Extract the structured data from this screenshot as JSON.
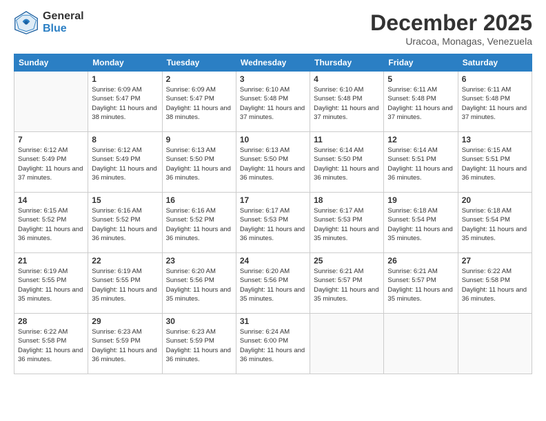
{
  "logo": {
    "general": "General",
    "blue": "Blue"
  },
  "title": "December 2025",
  "subtitle": "Uracoa, Monagas, Venezuela",
  "days_header": [
    "Sunday",
    "Monday",
    "Tuesday",
    "Wednesday",
    "Thursday",
    "Friday",
    "Saturday"
  ],
  "weeks": [
    [
      {
        "day": "",
        "sunrise": "",
        "sunset": "",
        "daylight": ""
      },
      {
        "day": "1",
        "sunrise": "6:09 AM",
        "sunset": "5:47 PM",
        "daylight": "11 hours and 38 minutes."
      },
      {
        "day": "2",
        "sunrise": "6:09 AM",
        "sunset": "5:47 PM",
        "daylight": "11 hours and 38 minutes."
      },
      {
        "day": "3",
        "sunrise": "6:10 AM",
        "sunset": "5:48 PM",
        "daylight": "11 hours and 37 minutes."
      },
      {
        "day": "4",
        "sunrise": "6:10 AM",
        "sunset": "5:48 PM",
        "daylight": "11 hours and 37 minutes."
      },
      {
        "day": "5",
        "sunrise": "6:11 AM",
        "sunset": "5:48 PM",
        "daylight": "11 hours and 37 minutes."
      },
      {
        "day": "6",
        "sunrise": "6:11 AM",
        "sunset": "5:48 PM",
        "daylight": "11 hours and 37 minutes."
      }
    ],
    [
      {
        "day": "7",
        "sunrise": "6:12 AM",
        "sunset": "5:49 PM",
        "daylight": "11 hours and 37 minutes."
      },
      {
        "day": "8",
        "sunrise": "6:12 AM",
        "sunset": "5:49 PM",
        "daylight": "11 hours and 36 minutes."
      },
      {
        "day": "9",
        "sunrise": "6:13 AM",
        "sunset": "5:50 PM",
        "daylight": "11 hours and 36 minutes."
      },
      {
        "day": "10",
        "sunrise": "6:13 AM",
        "sunset": "5:50 PM",
        "daylight": "11 hours and 36 minutes."
      },
      {
        "day": "11",
        "sunrise": "6:14 AM",
        "sunset": "5:50 PM",
        "daylight": "11 hours and 36 minutes."
      },
      {
        "day": "12",
        "sunrise": "6:14 AM",
        "sunset": "5:51 PM",
        "daylight": "11 hours and 36 minutes."
      },
      {
        "day": "13",
        "sunrise": "6:15 AM",
        "sunset": "5:51 PM",
        "daylight": "11 hours and 36 minutes."
      }
    ],
    [
      {
        "day": "14",
        "sunrise": "6:15 AM",
        "sunset": "5:52 PM",
        "daylight": "11 hours and 36 minutes."
      },
      {
        "day": "15",
        "sunrise": "6:16 AM",
        "sunset": "5:52 PM",
        "daylight": "11 hours and 36 minutes."
      },
      {
        "day": "16",
        "sunrise": "6:16 AM",
        "sunset": "5:52 PM",
        "daylight": "11 hours and 36 minutes."
      },
      {
        "day": "17",
        "sunrise": "6:17 AM",
        "sunset": "5:53 PM",
        "daylight": "11 hours and 36 minutes."
      },
      {
        "day": "18",
        "sunrise": "6:17 AM",
        "sunset": "5:53 PM",
        "daylight": "11 hours and 35 minutes."
      },
      {
        "day": "19",
        "sunrise": "6:18 AM",
        "sunset": "5:54 PM",
        "daylight": "11 hours and 35 minutes."
      },
      {
        "day": "20",
        "sunrise": "6:18 AM",
        "sunset": "5:54 PM",
        "daylight": "11 hours and 35 minutes."
      }
    ],
    [
      {
        "day": "21",
        "sunrise": "6:19 AM",
        "sunset": "5:55 PM",
        "daylight": "11 hours and 35 minutes."
      },
      {
        "day": "22",
        "sunrise": "6:19 AM",
        "sunset": "5:55 PM",
        "daylight": "11 hours and 35 minutes."
      },
      {
        "day": "23",
        "sunrise": "6:20 AM",
        "sunset": "5:56 PM",
        "daylight": "11 hours and 35 minutes."
      },
      {
        "day": "24",
        "sunrise": "6:20 AM",
        "sunset": "5:56 PM",
        "daylight": "11 hours and 35 minutes."
      },
      {
        "day": "25",
        "sunrise": "6:21 AM",
        "sunset": "5:57 PM",
        "daylight": "11 hours and 35 minutes."
      },
      {
        "day": "26",
        "sunrise": "6:21 AM",
        "sunset": "5:57 PM",
        "daylight": "11 hours and 35 minutes."
      },
      {
        "day": "27",
        "sunrise": "6:22 AM",
        "sunset": "5:58 PM",
        "daylight": "11 hours and 36 minutes."
      }
    ],
    [
      {
        "day": "28",
        "sunrise": "6:22 AM",
        "sunset": "5:58 PM",
        "daylight": "11 hours and 36 minutes."
      },
      {
        "day": "29",
        "sunrise": "6:23 AM",
        "sunset": "5:59 PM",
        "daylight": "11 hours and 36 minutes."
      },
      {
        "day": "30",
        "sunrise": "6:23 AM",
        "sunset": "5:59 PM",
        "daylight": "11 hours and 36 minutes."
      },
      {
        "day": "31",
        "sunrise": "6:24 AM",
        "sunset": "6:00 PM",
        "daylight": "11 hours and 36 minutes."
      },
      {
        "day": "",
        "sunrise": "",
        "sunset": "",
        "daylight": ""
      },
      {
        "day": "",
        "sunrise": "",
        "sunset": "",
        "daylight": ""
      },
      {
        "day": "",
        "sunrise": "",
        "sunset": "",
        "daylight": ""
      }
    ]
  ]
}
